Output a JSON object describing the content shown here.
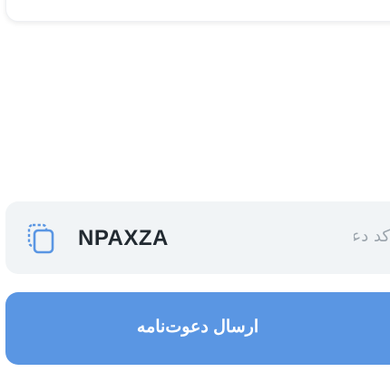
{
  "invite": {
    "code_label": "کد دعوت شما",
    "code": "NPAXZA",
    "copy_icon": "copy-icon"
  },
  "actions": {
    "send_invitation_label": "ارسال دعوت‌نامه"
  },
  "colors": {
    "primary": "#5a96e3",
    "surface": "#f1f4f6",
    "text": "#222a31",
    "muted": "#9aa3ab",
    "icon": "#5a96e3"
  }
}
